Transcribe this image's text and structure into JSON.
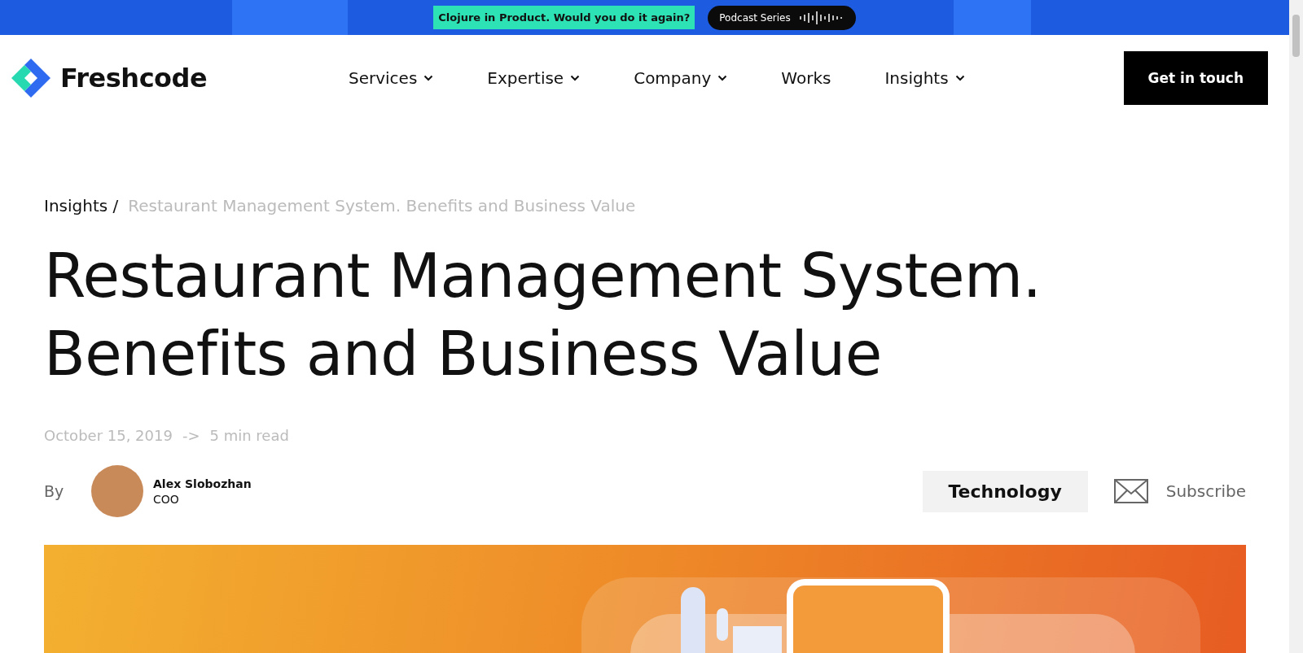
{
  "promo_bar": {
    "text": "Clojure in Product. Would you do it again?",
    "podcast_button": "Podcast Series"
  },
  "header": {
    "logo": "Freshcode",
    "nav": [
      {
        "label": "Services",
        "dropdown": true
      },
      {
        "label": "Expertise",
        "dropdown": true
      },
      {
        "label": "Company",
        "dropdown": true
      },
      {
        "label": "Works",
        "dropdown": false
      },
      {
        "label": "Insights",
        "dropdown": true
      }
    ],
    "cta": "Get in touch"
  },
  "breadcrumb": {
    "parent": "Insights /",
    "current": "Restaurant Management System. Benefits and Business Value"
  },
  "title_lines": [
    "Restaurant Management System.",
    "Benefits and Business Value"
  ],
  "meta": {
    "date": "October 15, 2019",
    "arrow": "->",
    "read_time": "5 min read"
  },
  "author": {
    "by": "By",
    "name": "Alex Slobozhan",
    "role": "COO"
  },
  "tag": "Technology",
  "subscribe": "Subscribe"
}
